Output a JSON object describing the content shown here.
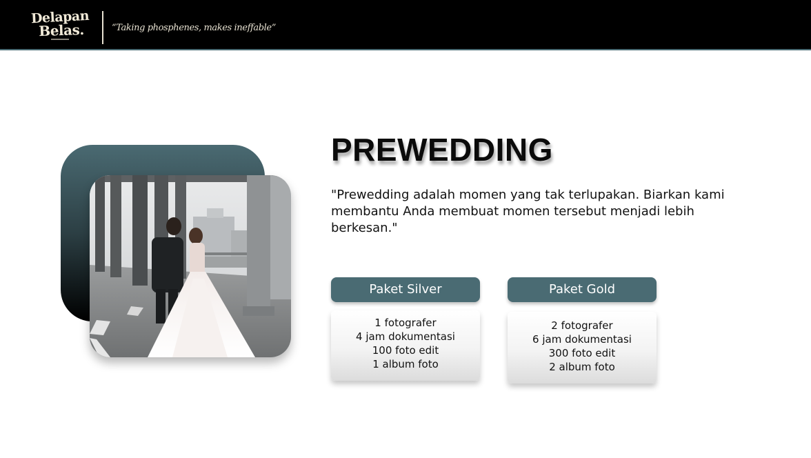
{
  "header": {
    "logo": {
      "line1": "Delapan",
      "line2": "Belas."
    },
    "tagline": "“Taking phosphenes, makes ineffable”"
  },
  "colors": {
    "header_bg": "#000000",
    "accent": "#4a6b73",
    "logo_text": "#f1ead8"
  },
  "main": {
    "photo": {
      "subject": "wedding couple walking under a bridge"
    },
    "title": "PREWEDDING",
    "description": "\"Prewedding adalah momen yang tak terlupakan. Biarkan kami membantu Anda membuat momen tersebut menjadi lebih berkesan.\"",
    "packages": [
      {
        "name": "Paket Silver",
        "features": [
          "1 fotografer",
          "4 jam dokumentasi",
          "100 foto edit",
          "1 album foto"
        ]
      },
      {
        "name": "Paket Gold",
        "features": [
          "2 fotografer",
          "6 jam dokumentasi",
          "300 foto edit",
          "2 album foto"
        ]
      }
    ]
  }
}
